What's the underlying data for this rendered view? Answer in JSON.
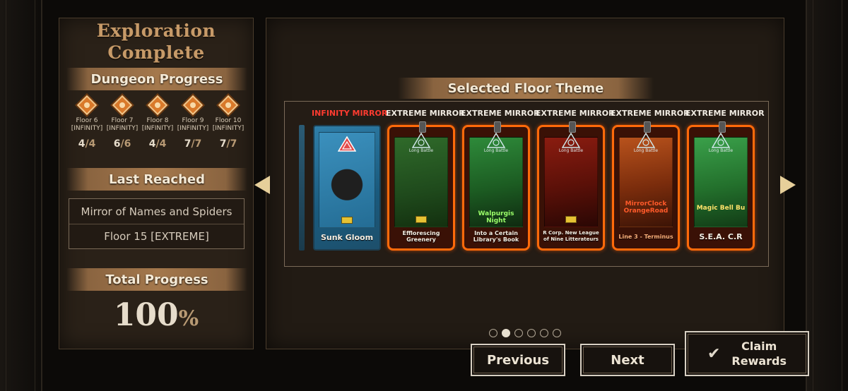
{
  "left_panel": {
    "title_line1": "Exploration",
    "title_line2": "Complete",
    "dungeon_progress_label": "Dungeon Progress",
    "floors": [
      {
        "floor": "Floor 6",
        "mode": "[INFINITY]",
        "current": "4",
        "max": "4"
      },
      {
        "floor": "Floor 7",
        "mode": "[INFINITY]",
        "current": "6",
        "max": "6"
      },
      {
        "floor": "Floor 8",
        "mode": "[INFINITY]",
        "current": "4",
        "max": "4"
      },
      {
        "floor": "Floor 9",
        "mode": "[INFINITY]",
        "current": "7",
        "max": "7"
      },
      {
        "floor": "Floor 10",
        "mode": "[INFINITY]",
        "current": "7",
        "max": "7"
      }
    ],
    "last_reached_label": "Last Reached",
    "last_reached_mirror": "Mirror of Names and Spiders",
    "last_reached_floor": "Floor 15 [EXTREME]",
    "total_progress_label": "Total Progress",
    "total_progress_value": "100",
    "total_progress_unit": "%"
  },
  "main_panel": {
    "selected_theme_label": "Selected Floor Theme",
    "cards": [
      {
        "type": "INFINITY MIRROR",
        "name": "Sunk Gloom",
        "logo_text": ""
      },
      {
        "type": "EXTREME MIRROR",
        "name": "Efflorescing Greenery",
        "logo_text": "Long Battle"
      },
      {
        "type": "EXTREME MIRROR",
        "name": "Into a Certain Library's Book",
        "logo_text": "Long Battle",
        "overlay": "Walpurgis Night"
      },
      {
        "type": "EXTREME MIRROR",
        "name": "R Corp. New League of Nine Litterateurs",
        "logo_text": "Long Battle"
      },
      {
        "type": "EXTREME MIRROR",
        "name": "Line 3 - Terminus",
        "logo_text": "Long Battle",
        "overlay": "MirrorClock OrangeRoad"
      },
      {
        "type": "EXTREME MIRROR",
        "name": "S.E.A. C.R",
        "logo_text": "Long Battle",
        "overlay": "Magic Bell Bu"
      }
    ],
    "pagination": {
      "total": 6,
      "active": 1
    }
  },
  "buttons": {
    "previous": "Previous",
    "next": "Next",
    "claim_line1": "Claim",
    "claim_line2": "Rewards"
  },
  "colors": {
    "extreme_frame": "#ff6a0a",
    "infinity_label": "#ff3b30",
    "banner": "#a4784c",
    "title": "#c79a68"
  }
}
